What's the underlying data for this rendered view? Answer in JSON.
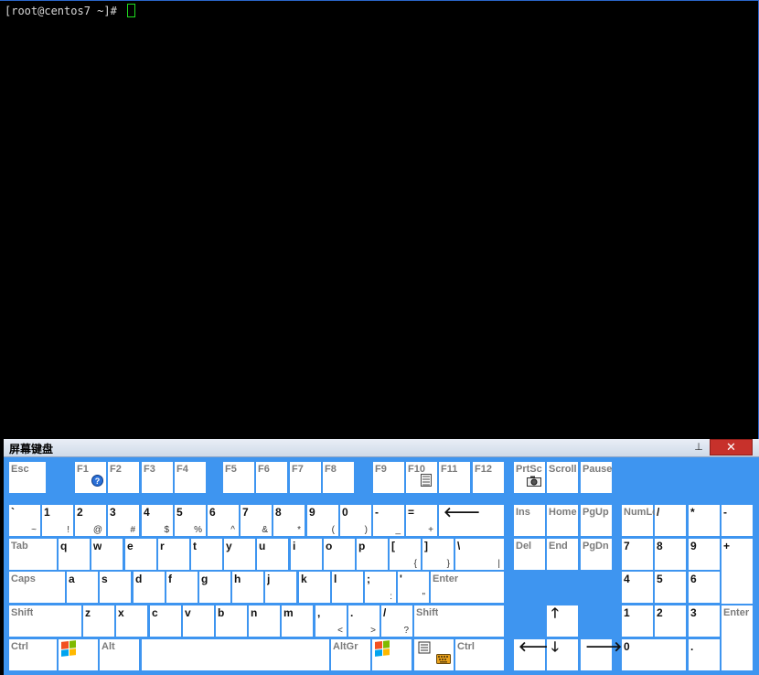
{
  "terminal": {
    "prompt": "[root@centos7 ~]# "
  },
  "keyboard": {
    "title": "屏幕键盘",
    "pin_glyph": "⊥",
    "close_glyph": "✕",
    "win_colors": [
      "#f25022",
      "#7fba00",
      "#00a4ef",
      "#ffb900"
    ],
    "rows": {
      "fn": [
        {
          "id": "esc",
          "m": "Esc",
          "f": true
        },
        {
          "id": "f1",
          "m": "F1",
          "f": true
        },
        {
          "id": "f2",
          "m": "F2",
          "f": true
        },
        {
          "id": "f3",
          "m": "F3",
          "f": true
        },
        {
          "id": "f4",
          "m": "F4",
          "f": true
        },
        {
          "id": "f5",
          "m": "F5",
          "f": true
        },
        {
          "id": "f6",
          "m": "F6",
          "f": true
        },
        {
          "id": "f7",
          "m": "F7",
          "f": true
        },
        {
          "id": "f8",
          "m": "F8",
          "f": true
        },
        {
          "id": "f9",
          "m": "F9",
          "f": true
        },
        {
          "id": "f10",
          "m": "F10",
          "f": true
        },
        {
          "id": "f11",
          "m": "F11",
          "f": true
        },
        {
          "id": "f12",
          "m": "F12",
          "f": true
        },
        {
          "id": "prtsc",
          "m": "PrtSc",
          "f": true
        },
        {
          "id": "scroll",
          "m": "Scroll",
          "f": true
        },
        {
          "id": "pause",
          "m": "Pause",
          "f": true
        }
      ],
      "num": [
        {
          "id": "backtick",
          "m": "`",
          "s": "~"
        },
        {
          "id": "1",
          "m": "1",
          "s": "!"
        },
        {
          "id": "2",
          "m": "2",
          "s": "@"
        },
        {
          "id": "3",
          "m": "3",
          "s": "#"
        },
        {
          "id": "4",
          "m": "4",
          "s": "$"
        },
        {
          "id": "5",
          "m": "5",
          "s": "%"
        },
        {
          "id": "6",
          "m": "6",
          "s": "^"
        },
        {
          "id": "7",
          "m": "7",
          "s": "&"
        },
        {
          "id": "8",
          "m": "8",
          "s": "*"
        },
        {
          "id": "9",
          "m": "9",
          "s": "("
        },
        {
          "id": "0",
          "m": "0",
          "s": ")"
        },
        {
          "id": "minus",
          "m": "-",
          "s": "_"
        },
        {
          "id": "equals",
          "m": "=",
          "s": "+"
        },
        {
          "id": "backspace",
          "m": "🡐"
        },
        {
          "id": "ins",
          "m": "Ins",
          "f": true
        },
        {
          "id": "home",
          "m": "Home",
          "f": true
        },
        {
          "id": "pgup",
          "m": "PgUp",
          "f": true
        },
        {
          "id": "numlock",
          "m": "NumLock",
          "f": true
        },
        {
          "id": "np-slash",
          "m": "/"
        },
        {
          "id": "np-star",
          "m": "*"
        },
        {
          "id": "np-minus",
          "m": "-"
        }
      ],
      "tab": [
        {
          "id": "tab",
          "m": "Tab",
          "f": true
        },
        {
          "id": "q",
          "m": "q"
        },
        {
          "id": "w",
          "m": "w"
        },
        {
          "id": "e",
          "m": "e"
        },
        {
          "id": "r",
          "m": "r"
        },
        {
          "id": "t",
          "m": "t"
        },
        {
          "id": "y",
          "m": "y"
        },
        {
          "id": "u",
          "m": "u"
        },
        {
          "id": "i",
          "m": "i"
        },
        {
          "id": "o",
          "m": "o"
        },
        {
          "id": "p",
          "m": "p"
        },
        {
          "id": "lbracket",
          "m": "[",
          "s": "{"
        },
        {
          "id": "rbracket",
          "m": "]",
          "s": "}"
        },
        {
          "id": "backslash",
          "m": "\\",
          "s": "|"
        },
        {
          "id": "del",
          "m": "Del",
          "f": true
        },
        {
          "id": "end",
          "m": "End",
          "f": true
        },
        {
          "id": "pgdn",
          "m": "PgDn",
          "f": true
        },
        {
          "id": "np7",
          "m": "7"
        },
        {
          "id": "np8",
          "m": "8"
        },
        {
          "id": "np9",
          "m": "9"
        },
        {
          "id": "np-plus",
          "m": "+"
        }
      ],
      "caps": [
        {
          "id": "caps",
          "m": "Caps",
          "f": true
        },
        {
          "id": "a",
          "m": "a"
        },
        {
          "id": "s",
          "m": "s"
        },
        {
          "id": "d",
          "m": "d"
        },
        {
          "id": "f",
          "m": "f"
        },
        {
          "id": "g",
          "m": "g"
        },
        {
          "id": "h",
          "m": "h"
        },
        {
          "id": "j",
          "m": "j"
        },
        {
          "id": "k",
          "m": "k"
        },
        {
          "id": "l",
          "m": "l"
        },
        {
          "id": "semicolon",
          "m": ";",
          "s": ":"
        },
        {
          "id": "quote",
          "m": "'",
          "s": "\""
        },
        {
          "id": "enter",
          "m": "Enter",
          "f": true
        },
        {
          "id": "np4",
          "m": "4"
        },
        {
          "id": "np5",
          "m": "5"
        },
        {
          "id": "np6",
          "m": "6"
        }
      ],
      "shift": [
        {
          "id": "lshift",
          "m": "Shift",
          "f": true
        },
        {
          "id": "z",
          "m": "z"
        },
        {
          "id": "x",
          "m": "x"
        },
        {
          "id": "c",
          "m": "c"
        },
        {
          "id": "v",
          "m": "v"
        },
        {
          "id": "b",
          "m": "b"
        },
        {
          "id": "n",
          "m": "n"
        },
        {
          "id": "m",
          "m": "m"
        },
        {
          "id": "comma",
          "m": ",",
          "s": "<"
        },
        {
          "id": "period",
          "m": ".",
          "s": ">"
        },
        {
          "id": "slash",
          "m": "/",
          "s": "?"
        },
        {
          "id": "rshift",
          "m": "Shift",
          "f": true
        },
        {
          "id": "up",
          "m": "🡑"
        },
        {
          "id": "np1",
          "m": "1"
        },
        {
          "id": "np2",
          "m": "2"
        },
        {
          "id": "np3",
          "m": "3"
        },
        {
          "id": "np-enter",
          "m": "Enter",
          "f": true
        }
      ],
      "ctrl": [
        {
          "id": "lctrl",
          "m": "Ctrl",
          "f": true
        },
        {
          "id": "lwin",
          "m": ""
        },
        {
          "id": "alt",
          "m": "Alt",
          "f": true
        },
        {
          "id": "space",
          "m": ""
        },
        {
          "id": "altgr",
          "m": "AltGr",
          "f": true
        },
        {
          "id": "rwin",
          "m": ""
        },
        {
          "id": "menu",
          "m": ""
        },
        {
          "id": "rctrl",
          "m": "Ctrl",
          "f": true
        },
        {
          "id": "left",
          "m": "🡐"
        },
        {
          "id": "down",
          "m": "🡓"
        },
        {
          "id": "right",
          "m": "🡒"
        },
        {
          "id": "np0",
          "m": "0"
        },
        {
          "id": "np-dot",
          "m": "."
        }
      ]
    }
  }
}
